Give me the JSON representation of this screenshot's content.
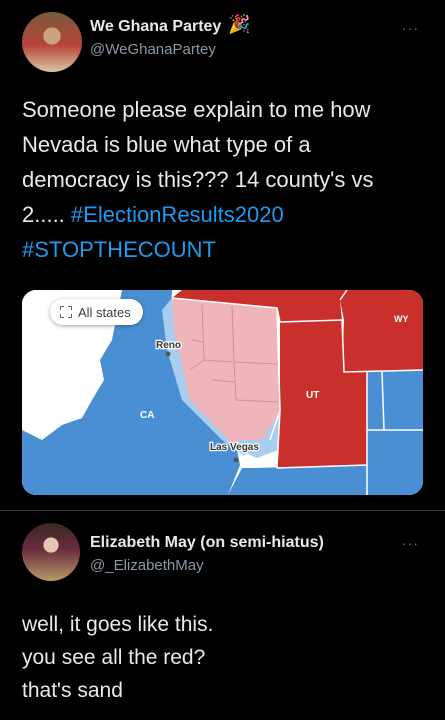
{
  "tweet1": {
    "name": "We Ghana Partey",
    "name_emoji": "🎉",
    "handle": "@WeGhanaPartey",
    "more": "···",
    "text_lines": [
      "Someone please explain to me how",
      "Nevada is blue what type of a",
      "democracy is this??? 14 county's vs",
      "2..... "
    ],
    "hashtag1": "#ElectionResults2020",
    "hashtag2": "#STOPTHECOUNT",
    "map": {
      "button_label": "All states",
      "labels": {
        "reno": "Reno",
        "ca": "CA",
        "ut": "UT",
        "las_vegas": "Las Vegas",
        "wy": "WY"
      },
      "colors": {
        "blue": "#4a8fd4",
        "light_blue": "#a9cdee",
        "red": "#c9302c",
        "pink": "#f0b4bb",
        "water": "#ffffff"
      }
    }
  },
  "tweet2": {
    "name": "Elizabeth May (on semi-hiatus)",
    "handle": "@_ElizabethMay",
    "more": "···",
    "text_lines": [
      "well, it goes like this.",
      "you see all the red?",
      "that's sand"
    ]
  }
}
